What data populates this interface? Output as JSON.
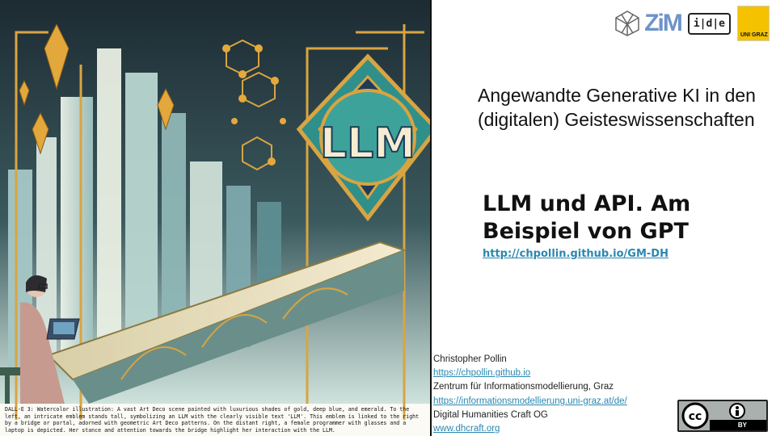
{
  "caption": "DALL-E 3: Watercolor illustration: A vast Art Deco scene painted with luxurious shades of gold, deep blue, and emerald. To the left, an intricate emblem stands tall, symbolizing an LLM with the clearly visible text 'LLM'. This emblem is linked to the right by a bridge or portal, adorned with geometric Art Deco patterns. On the distant right, a female programmer with glasses and a laptop is depicted. Her stance and attention towards the bridge highlight her interaction with the LLM.",
  "emblem_text": "LLM",
  "logos": {
    "zim": "ZiM",
    "idle": "i|d|e",
    "uni": "UNI GRAZ"
  },
  "title": "Angewandte Generative KI in den (digitalen) Geisteswissenschaften",
  "subtitle": "LLM und API. Am Beispiel von GPT",
  "url": "http://chpollin.github.io/GM-DH",
  "contact": {
    "name": "Christopher Pollin",
    "link1": "https://chpollin.github.io",
    "org1": "Zentrum für Informationsmodellierung, Graz",
    "link2": "https://informationsmodellierung.uni-graz.at/de/",
    "org2": "Digital Humanities Craft OG",
    "link3": "www.dhcraft.org"
  },
  "license": {
    "cc": "cc",
    "by": "BY"
  },
  "colors": {
    "gold": "#d9a441",
    "teal": "#2f8f8a",
    "deep_blue": "#1f3b5a",
    "link": "#2a87b0"
  }
}
